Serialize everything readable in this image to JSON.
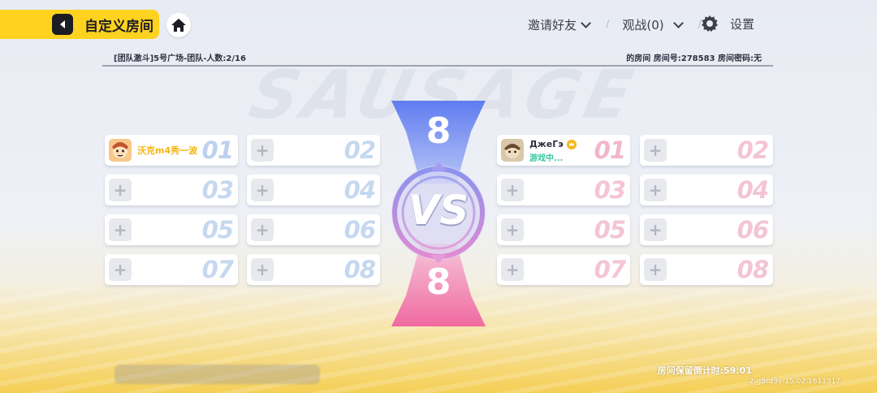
{
  "header": {
    "title": "自定义房间",
    "invite_label": "邀请好友",
    "spectate_label": "观战(0)",
    "settings_label": "设置"
  },
  "info": {
    "left": "[团队激斗]5号广场-团队-人数:2/16",
    "right": "的房间 房间号:278583 房间密码:无"
  },
  "background_logo": "SAUSAGE",
  "team_blue": {
    "count": "8",
    "slots": [
      {
        "num": "01",
        "player": "沃克m4秀一波"
      },
      {
        "num": "02"
      },
      {
        "num": "03"
      },
      {
        "num": "04"
      },
      {
        "num": "05"
      },
      {
        "num": "06"
      },
      {
        "num": "07"
      },
      {
        "num": "08"
      }
    ]
  },
  "team_pink": {
    "count": "8",
    "slots": [
      {
        "num": "01",
        "player": "ДжеГэ",
        "status": "游戏中..."
      },
      {
        "num": "02"
      },
      {
        "num": "03"
      },
      {
        "num": "04"
      },
      {
        "num": "05"
      },
      {
        "num": "06"
      },
      {
        "num": "07"
      },
      {
        "num": "08"
      }
    ]
  },
  "vs_label": "VS",
  "footer": {
    "countdown": "房间保留倒计时:59:01",
    "version": "2-g5rd3y-15.02.1611317"
  },
  "colors": {
    "accent_yellow": "#ffd21f",
    "team_blue": "#6f8df0",
    "team_pink": "#f27aa8",
    "player_name_gold": "#f5b50f",
    "status_green": "#39c6a0"
  }
}
